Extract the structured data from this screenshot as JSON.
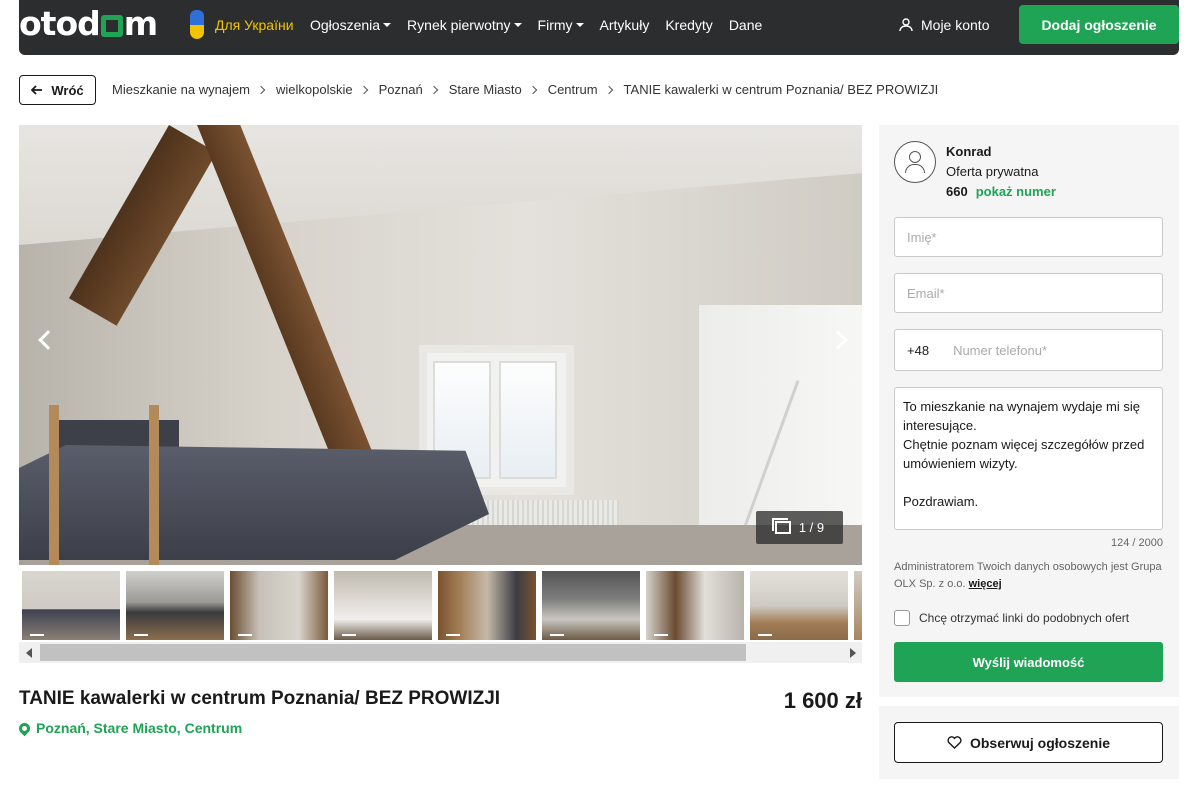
{
  "header": {
    "logo": "otodom",
    "ukraine_label": "Для України",
    "nav": [
      {
        "label": "Ogłoszenia",
        "dropdown": true
      },
      {
        "label": "Rynek pierwotny",
        "dropdown": true
      },
      {
        "label": "Firmy",
        "dropdown": true
      },
      {
        "label": "Artykuły",
        "dropdown": false
      },
      {
        "label": "Kredyty",
        "dropdown": false
      },
      {
        "label": "Dane",
        "dropdown": false
      }
    ],
    "account_label": "Moje konto",
    "add_label": "Dodaj ogłoszenie"
  },
  "back_label": "Wróć",
  "breadcrumb": [
    "Mieszkanie na wynajem",
    "wielkopolskie",
    "Poznań",
    "Stare Miasto",
    "Centrum",
    "TANIE kawalerki w centrum Poznania/ BEZ PROWIZJI"
  ],
  "gallery": {
    "counter": "1 / 9",
    "thumbnail_count": 9
  },
  "listing": {
    "title": "TANIE kawalerki w centrum Poznania/ BEZ PROWIZJI",
    "location": "Poznań, Stare Miasto, Centrum",
    "price": "1 600 zł"
  },
  "contact": {
    "seller_name": "Konrad",
    "seller_type": "Oferta prywatna",
    "phone_prefix": "660",
    "show_number": "pokaż numer",
    "name_placeholder": "Imię*",
    "email_placeholder": "Email*",
    "phone_country": "+48",
    "phone_placeholder": "Numer telefonu*",
    "message": "To mieszkanie na wynajem wydaje mi się interesujące.\nChętnie poznam więcej szczegółów przed umówieniem wizyty.\n\nPozdrawiam.",
    "char_count": "124 / 2000",
    "admin_note": "Administratorem Twoich danych osobowych jest Grupa OLX Sp. z o.o.",
    "admin_more": "więcej",
    "similar_checkbox": "Chcę otrzymać linki do podobnych ofert",
    "send_label": "Wyślij wiadomość",
    "watch_label": "Obserwuj ogłoszenie"
  },
  "colors": {
    "brand_green": "#1fa355",
    "header_bg": "#2c2d2f",
    "panel_bg": "#f5f5f5"
  }
}
